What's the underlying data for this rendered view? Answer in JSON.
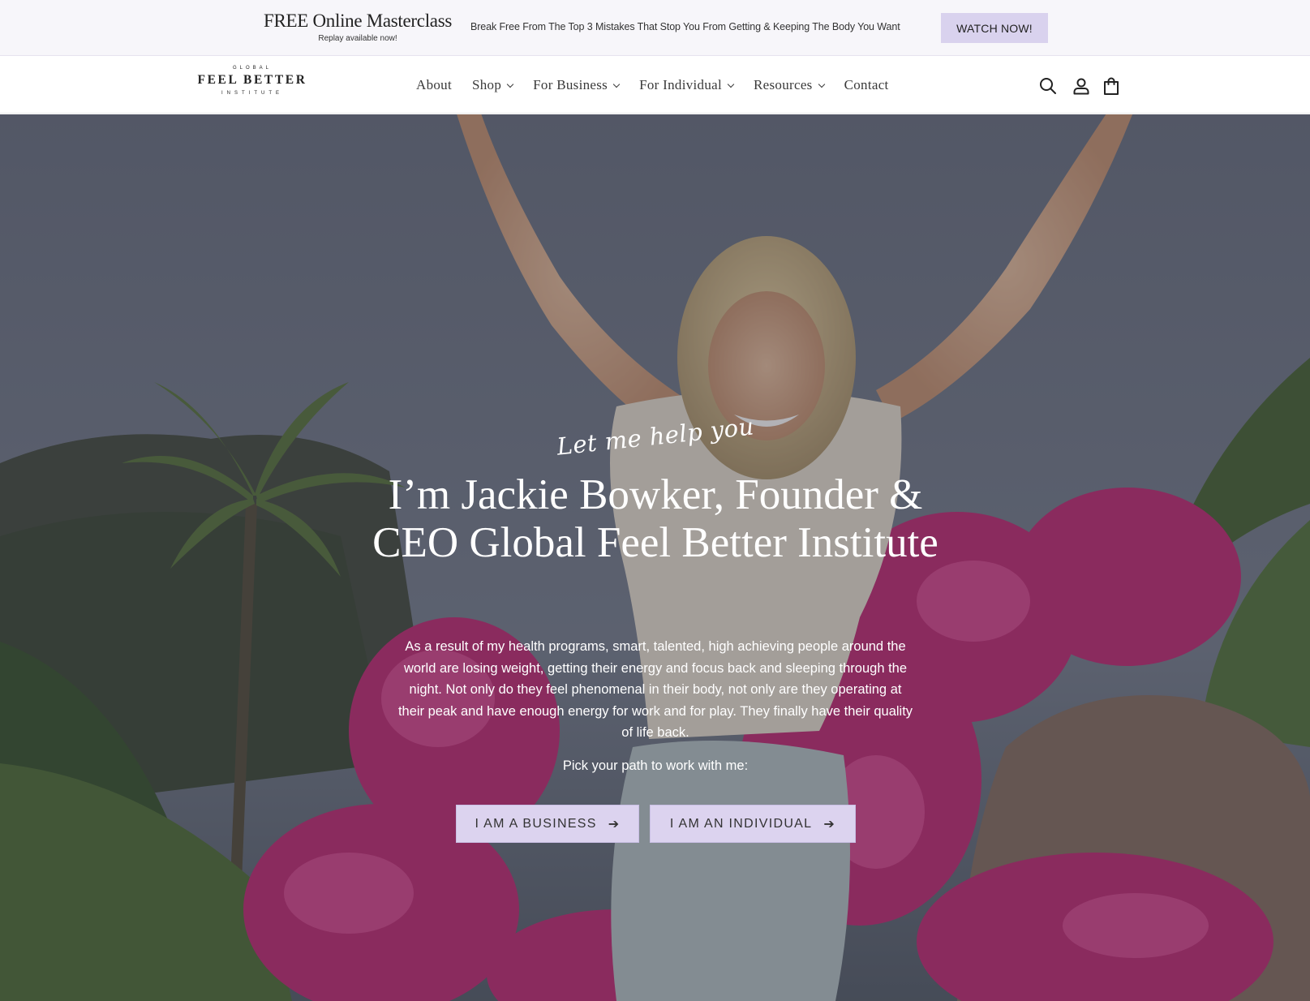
{
  "promo": {
    "title": "FREE Online Masterclass",
    "subtitle": "Replay available now!",
    "text": "Break Free From The Top 3 Mistakes That Stop You From Getting & Keeping The Body You Want",
    "button": "WATCH NOW!",
    "button_color": "#d9d2ee"
  },
  "logo": {
    "top": "GLOBAL",
    "main": "FEEL BETTER",
    "bottom": "INSTITUTE"
  },
  "nav": {
    "items": [
      {
        "label": "About",
        "dropdown": false
      },
      {
        "label": "Shop",
        "dropdown": true
      },
      {
        "label": "For Business",
        "dropdown": true
      },
      {
        "label": "For Individual",
        "dropdown": true
      },
      {
        "label": "Resources",
        "dropdown": true
      },
      {
        "label": "Contact",
        "dropdown": false
      }
    ],
    "icons": [
      "search-icon",
      "account-icon",
      "cart-icon"
    ]
  },
  "hero": {
    "script": "Let me help you",
    "title": "I’m Jackie Bowker, Founder & CEO Global Feel Better Institute",
    "body": "As a result of my health programs, smart, talented, high achieving people around the world are losing weight, getting their energy and focus back and sleeping through the night. Not only do they feel phenomenal in their body, not only are they operating at their peak and have enough energy for work and for play. They finally have their quality of life back.",
    "path_prompt": "Pick your path to work with me:",
    "buttons": [
      {
        "label": "I AM A BUSINESS"
      },
      {
        "label": "I AM AN INDIVIDUAL"
      }
    ],
    "button_color": "#dcd3ef"
  }
}
